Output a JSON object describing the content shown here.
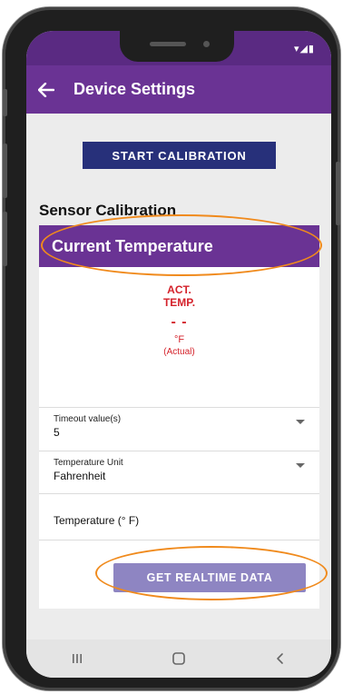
{
  "status_icons": "▾◢▮",
  "appbar": {
    "title": "Device Settings"
  },
  "buttons": {
    "start_calibration": "START CALIBRATION",
    "get_realtime": "GET REALTIME DATA"
  },
  "section": {
    "title": "Sensor Calibration"
  },
  "card": {
    "header": "Current Temperature",
    "reading": {
      "label_line1": "ACT.",
      "label_line2": "TEMP.",
      "value": "- -",
      "unit": "°F",
      "qualifier": "(Actual)"
    }
  },
  "fields": {
    "timeout": {
      "label": "Timeout value(s)",
      "value": "5"
    },
    "temp_unit": {
      "label": "Temperature Unit",
      "value": "Fahrenheit"
    },
    "temperature": {
      "label": "Temperature (° F)"
    }
  },
  "colors": {
    "status_bar": "#5a2a82",
    "app_bar": "#6a3394",
    "primary_button": "#27307a",
    "secondary_button": "#8e85c2",
    "reading_red": "#d4222b",
    "highlight_orange": "#f08a1c"
  },
  "icons": {
    "back": "arrow-left-icon",
    "dropdown": "caret-down-icon",
    "nav_recents": "recents-icon",
    "nav_home": "home-icon",
    "nav_back": "chevron-left-icon"
  }
}
